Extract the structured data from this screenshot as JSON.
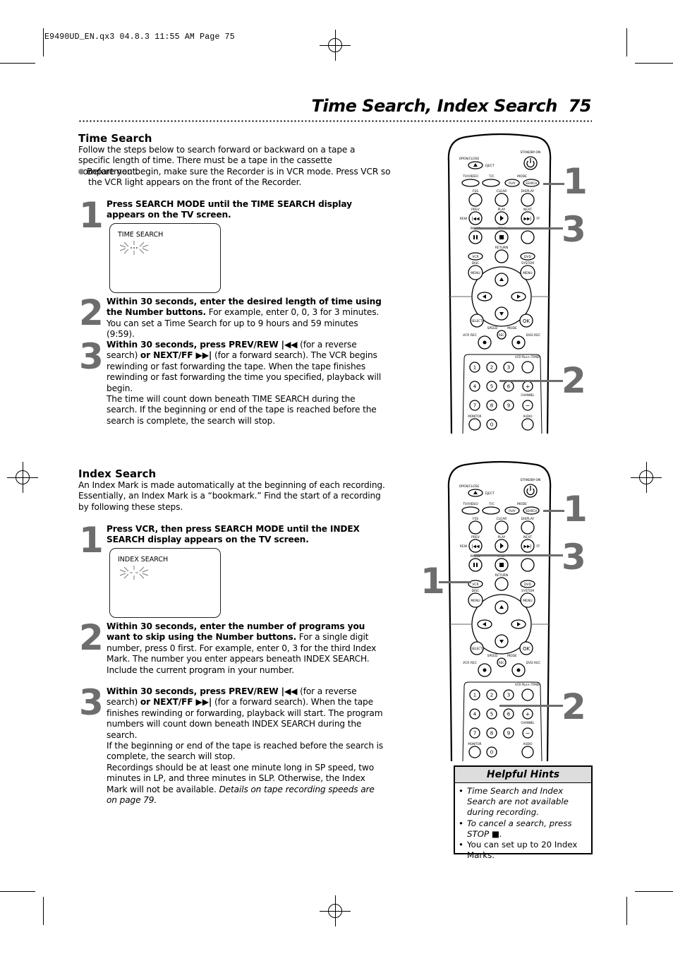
{
  "slug": "E9490UD_EN.qx3  04.8.3  11:55 AM  Page 75",
  "header": {
    "title": "Time Search, Index Search",
    "page_number": "75"
  },
  "time_search": {
    "heading": "Time Search",
    "intro": "Follow the steps below to search forward or backward on a tape a specific length of time. There must be a tape in the cassette compartment.",
    "bullet": "Before you begin, make sure the Recorder is in VCR mode. Press VCR so the VCR light appears on the front of the Recorder.",
    "steps": [
      {
        "num": "1",
        "bold": "Press SEARCH MODE until the TIME SEARCH display appears on the TV screen.",
        "text": ""
      },
      {
        "num": "2",
        "bold": "Within 30 seconds, enter the desired length of time using the Number buttons.",
        "text": " For example, enter 0, 0, 3 for 3 minutes. You can set a Time Search for up to 9 hours and 59 minutes (9:59)."
      },
      {
        "num": "3",
        "bold_a": "Within 30 seconds, press PREV/REW |◀◀",
        "text_a": " (for a reverse search) ",
        "bold_b": "or NEXT/FF ▶▶|",
        "text_b": " (for a forward search). The VCR begins rewinding or fast forwarding the tape. When the tape finishes rewinding or fast forwarding the time you specified, playback will begin.",
        "note": "The time will count down beneath TIME SEARCH during the search. If the beginning or end of the tape is reached before the search is complete, the search will stop."
      }
    ],
    "tv_label": "TIME SEARCH"
  },
  "index_search": {
    "heading": "Index Search",
    "intro": "An Index Mark is made automatically at the beginning of each recording. Essentially, an Index Mark is a “bookmark.” Find the start of a recording by following these steps.",
    "steps": [
      {
        "num": "1",
        "bold": "Press VCR, then press SEARCH MODE until the INDEX SEARCH display appears on the TV screen.",
        "text": ""
      },
      {
        "num": "2",
        "bold": "Within 30 seconds, enter the number of programs you want to skip using the Number buttons.",
        "text": " For a single digit number, press 0 first. For example, enter 0, 3 for the third Index Mark. The number you enter appears beneath INDEX SEARCH. Include the current program in your number."
      },
      {
        "num": "3",
        "bold_a": "Within 30 seconds, press PREV/REW |◀◀",
        "text_a": " (for a reverse search) ",
        "bold_b": "or NEXT/FF ▶▶|",
        "text_b": " (for a forward search). When the tape finishes rewinding or forwarding, playback will start. The program numbers will count down beneath INDEX SEARCH during the search.",
        "note": "If the beginning or end of the tape is reached before the search is complete, the search will stop.",
        "note2": "Recordings should be at least one minute long in SP speed, two minutes in LP, and three minutes in SLP. Otherwise, the Index Mark will not be available. ",
        "note2_italic": "Details on tape recording speeds are on page 79."
      }
    ],
    "tv_label": "INDEX SEARCH"
  },
  "remote": {
    "labels": {
      "standby": "STANDBY-ON",
      "open_close": "OPEN/CLOSE",
      "eject": "EJECT",
      "tv_video": "TV/VIDEO",
      "tc": "T/C",
      "mode": "MODE",
      "play_small": "PLAY",
      "search": "SEARCH",
      "fss": "FSS",
      "clear": "CLEAR",
      "display": "DISPLAY",
      "prev": "PREV",
      "play": "PLAY",
      "next": "NEXT",
      "rew": "REW",
      "ff": "FF",
      "pause": "PAUSE",
      "stop": "STOP",
      "return": "RETURN",
      "vcr": "VCR",
      "dvd": "DVD",
      "disc": "DISC",
      "system": "SYSTEM",
      "menu": "MENU",
      "select": "SELECT",
      "ok": "OK",
      "speed": "SPEED",
      "mode2": "MODE",
      "rec": "REC",
      "vcr_rec": "VCR REC",
      "dvd_rec": "DVD REC",
      "vcrplus": "VCR Plus+ /TIMER",
      "channel": "CHANNEL",
      "monitor": "MONITOR",
      "audio": "AUDIO"
    },
    "digits": [
      "1",
      "2",
      "3",
      "4",
      "5",
      "6",
      "7",
      "8",
      "9",
      "0"
    ],
    "callouts_top": [
      "1",
      "3",
      "2"
    ],
    "callouts_bottom": [
      "1",
      "3",
      "1",
      "2"
    ]
  },
  "hints": {
    "title": "Helpful Hints",
    "items": [
      {
        "text": "Time Search and Index Search are not available during recording.",
        "italic": true
      },
      {
        "text": "To cancel a search, press STOP ■.",
        "italic": true
      },
      {
        "text": "You can set up to 20 Index Marks.",
        "italic": false
      }
    ]
  }
}
